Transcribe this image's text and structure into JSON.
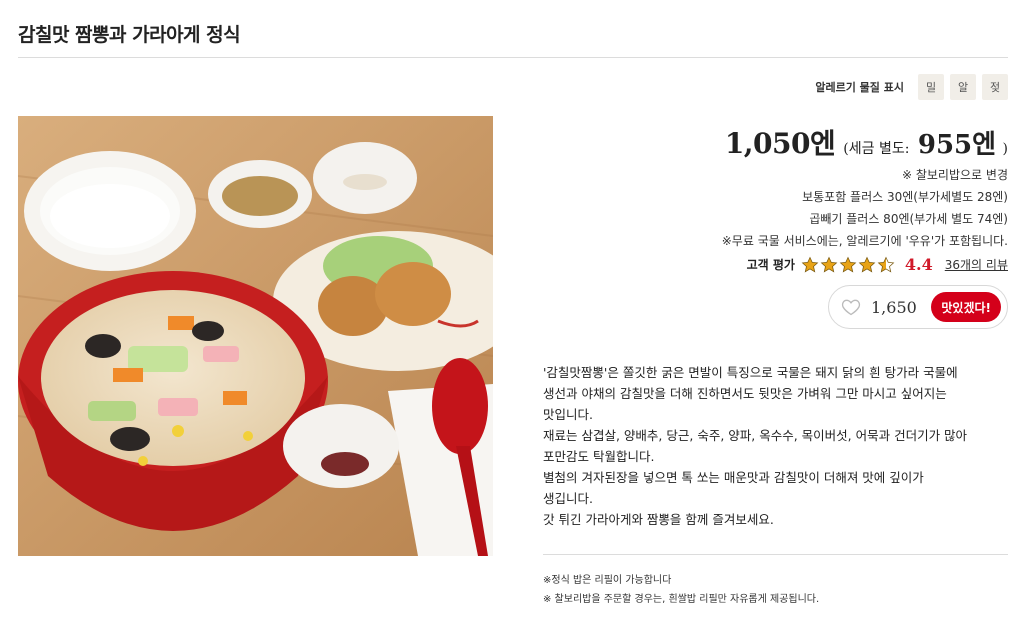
{
  "title": "감칠맛 짬뽕과 가라아게 정식",
  "allergen": {
    "label": "알레르기 물질 표시",
    "chips": [
      "밀",
      "알",
      "젖"
    ]
  },
  "price": {
    "main": "1,050엔",
    "sub_open": "(세금 별도:",
    "sub_value": "955엔",
    "sub_close": ")"
  },
  "info_lines": [
    "※ 찰보리밥으로 변경",
    "보통포함 플러스 30엔(부가세별도 28엔)",
    "곱빼기 플러스 80엔(부가세 별도 74엔)",
    "※무료 국물 서비스에는, 알레르기에 '우유'가 포함됩니다."
  ],
  "rating": {
    "label": "고객 평가",
    "value": "4.4",
    "stars_fraction": 0.88,
    "review_link": "36개의 리뷰"
  },
  "like": {
    "count": "1,650",
    "button": "맛있겠다!"
  },
  "description": [
    "'감칠맛짬뽕'은 쫄깃한 굵은 면발이 특징으로 국물은 돼지 닭의 흰 탕가라 국물에",
    "생선과 야채의 감칠맛을 더해 진하면서도 뒷맛은 가벼워 그만 마시고 싶어지는",
    "맛입니다.",
    "재료는 삼겹살, 양배추, 당근, 숙주, 양파, 옥수수, 목이버섯, 어묵과 건더기가 많아",
    "포만감도 탁월합니다.",
    "별첨의 겨자된장을 넣으면 톡 쏘는 매운맛과 감칠맛이 더해져 맛에 깊이가",
    "생깁니다.",
    "갓 튀긴 가라아게와 짬뽕을 함께 즐겨보세요."
  ],
  "notes": [
    "※정식 밥은 리필이 가능합니다",
    "※ 찰보리밥을 주문할 경우는, 흰쌀밥 리필만 자유롭게 제공됩니다."
  ],
  "colors": {
    "accent": "#d4001a",
    "rating": "#d11a2a",
    "star": "#e8a317"
  }
}
